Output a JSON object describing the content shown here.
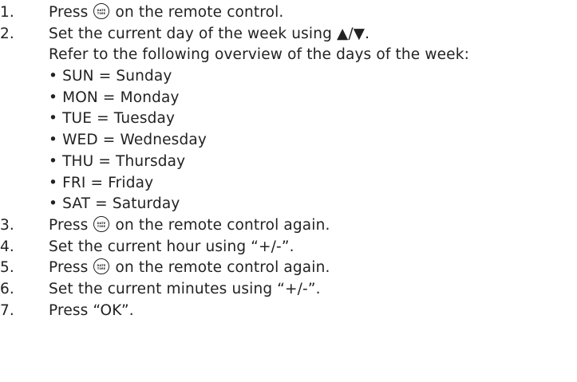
{
  "steps": {
    "s1": {
      "num": "1.",
      "pre": "Press ",
      "post": " on the remote control."
    },
    "s2": {
      "num": "2.",
      "text": "Set the current day of the week using ▲/▼."
    },
    "s2_intro": "Refer to the following overview of the days of the week:",
    "days": [
      "• SUN = Sunday",
      "• MON = Monday",
      "• TUE = Tuesday",
      "• WED = Wednesday",
      "• THU = Thursday",
      "• FRI = Friday",
      "• SAT = Saturday"
    ],
    "s3": {
      "num": "3.",
      "pre": "Press ",
      "post": " on the remote control again."
    },
    "s4": {
      "num": "4.",
      "text": "Set the current hour using “+/-”."
    },
    "s5": {
      "num": "5.",
      "pre": "Press ",
      "post": " on the remote control again."
    },
    "s6": {
      "num": "6.",
      "text": "Set the current minutes using “+/-”."
    },
    "s7": {
      "num": "7.",
      "text": "Press “OK”."
    }
  },
  "button_icon": {
    "name": "date-time-button-icon",
    "top": "DATE",
    "bottom": "TIME"
  }
}
